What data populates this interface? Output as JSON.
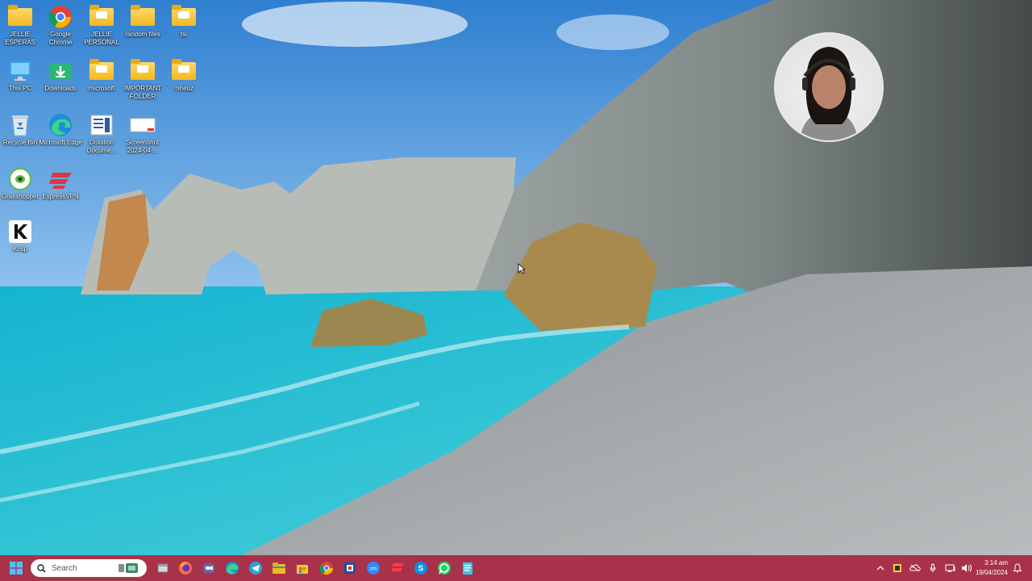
{
  "desktop": {
    "icons": [
      {
        "label": "JELLIE ESPERAS"
      },
      {
        "label": "Google Chrome"
      },
      {
        "label": "JELLIE PERSONAL"
      },
      {
        "label": "random files"
      },
      {
        "label": "tsi"
      },
      {
        "label": "This PC"
      },
      {
        "label": "Downloads"
      },
      {
        "label": "microsoft"
      },
      {
        "label": "IMPORTANT FOLDER"
      },
      {
        "label": "mheuz"
      },
      {
        "label": "Recycle Bin"
      },
      {
        "label": "Microsoft Edge"
      },
      {
        "label": "Doxillion Docume..."
      },
      {
        "label": "Screenshot 2024-04-..."
      },
      {
        "label": "Grasshopper"
      },
      {
        "label": "ExpressVPN"
      },
      {
        "label": "Krisp"
      }
    ]
  },
  "taskbar": {
    "search_placeholder": "Search",
    "pinned": [
      "file-explorer-small",
      "firefox",
      "teams",
      "edge",
      "telegram",
      "file-explorer",
      "microsoft-store",
      "chrome",
      "ms-app",
      "zoom",
      "expressvpn",
      "skype",
      "whatsapp",
      "notepad"
    ],
    "clock": {
      "time": "3:14 am",
      "date": "19/04/2024"
    }
  },
  "colors": {
    "taskbar": "#a8324a",
    "folder": "#f3b91e",
    "label_text": "#ffffff"
  }
}
